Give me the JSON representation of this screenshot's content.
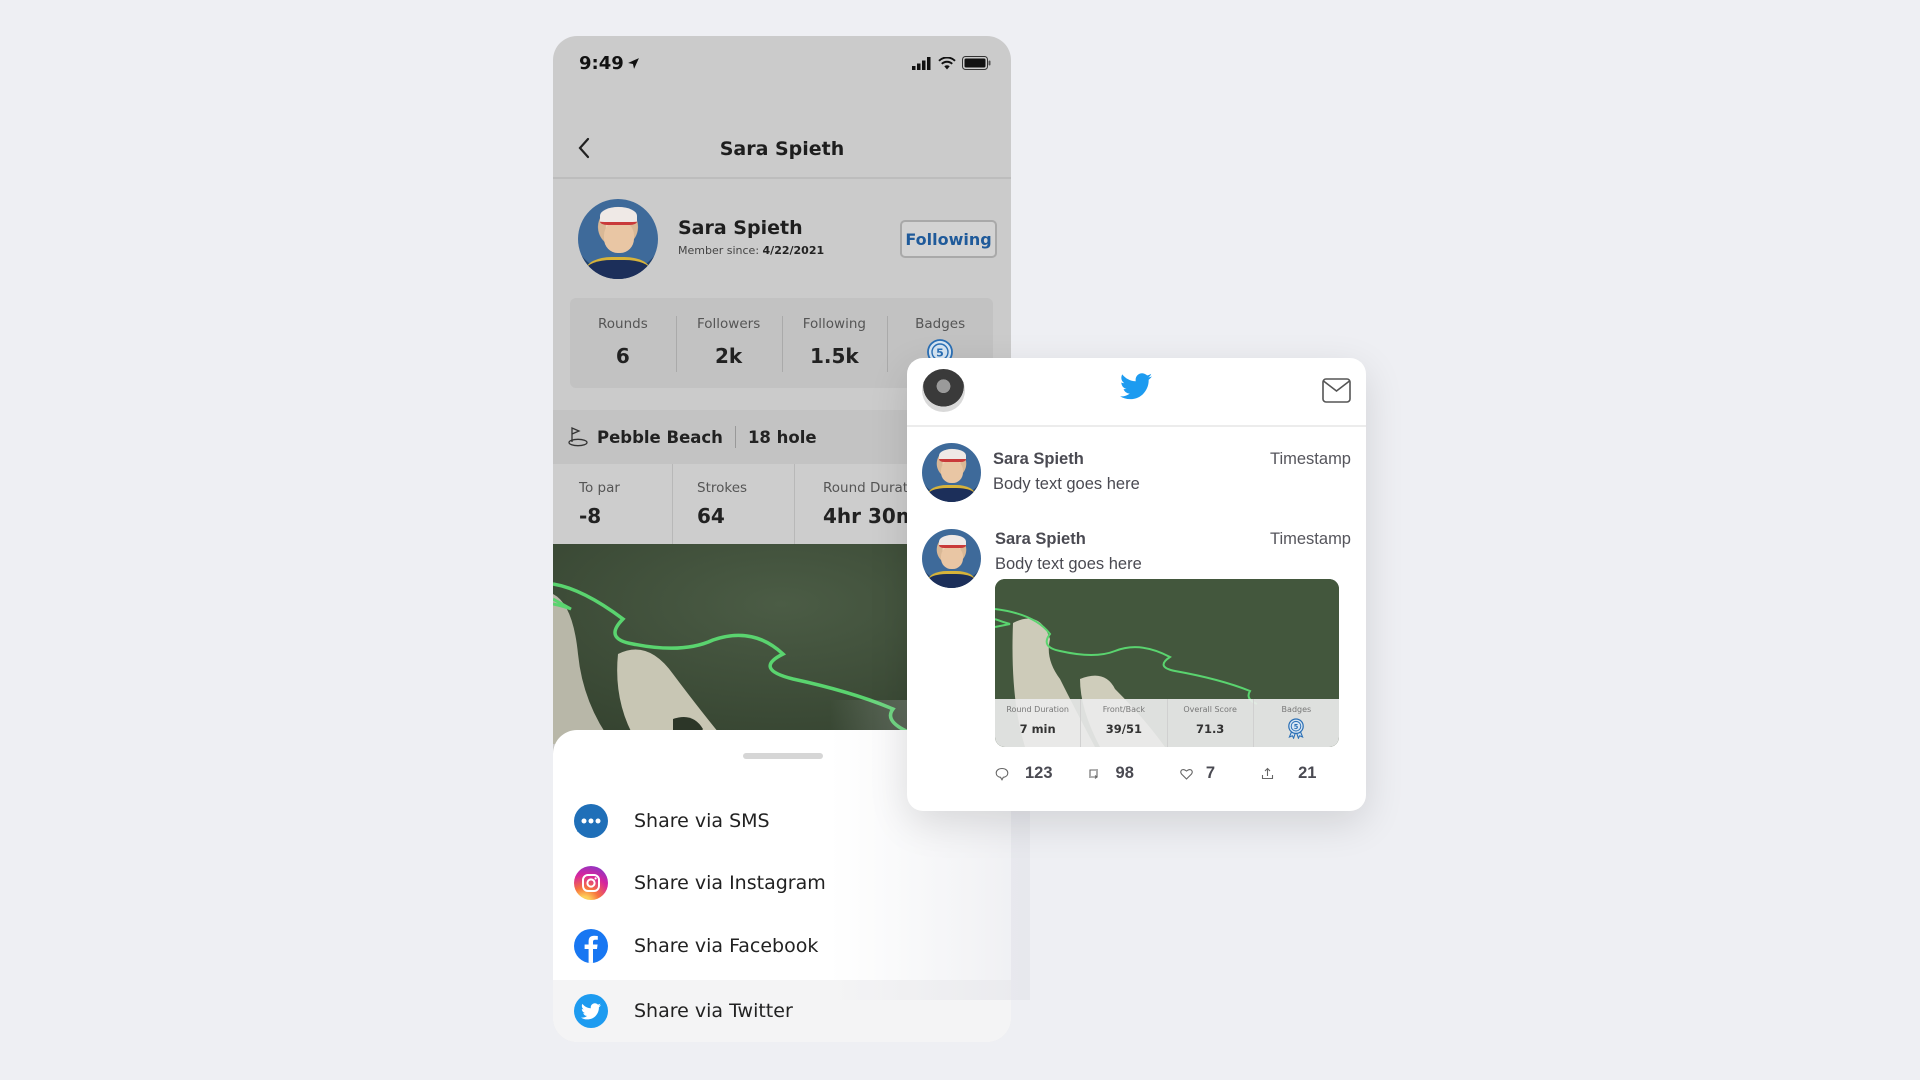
{
  "status_bar": {
    "time": "9:49"
  },
  "header": {
    "title": "Sara Spieth"
  },
  "profile": {
    "name": "Sara Spieth",
    "member_since_label": "Member since:",
    "member_since_date": "4/22/2021",
    "follow_button": "Following",
    "stats": [
      {
        "label": "Rounds",
        "value": "6"
      },
      {
        "label": "Followers",
        "value": "2k"
      },
      {
        "label": "Following",
        "value": "1.5k"
      },
      {
        "label": "Badges",
        "value": "5"
      }
    ]
  },
  "round": {
    "course": "Pebble Beach",
    "holes": "18 hole",
    "stats": [
      {
        "label": "To par",
        "value": "-8"
      },
      {
        "label": "Strokes",
        "value": "64"
      },
      {
        "label": "Round Duration",
        "value": "4hr 30min"
      }
    ]
  },
  "share_sheet": {
    "items": [
      {
        "label": "Share via SMS",
        "icon": "sms-icon",
        "color": "#1f6fb8"
      },
      {
        "label": "Share via Instagram",
        "icon": "instagram-icon",
        "color": "#d6249f"
      },
      {
        "label": "Share via Facebook",
        "icon": "facebook-icon",
        "color": "#1877f2"
      },
      {
        "label": "Share via Twitter",
        "icon": "twitter-icon",
        "color": "#1d9bf0"
      }
    ]
  },
  "twitter": {
    "brand_color": "#1d9bf0",
    "tweets": [
      {
        "name": "Sara Spieth",
        "timestamp": "Timestamp",
        "body": "Body text goes here"
      },
      {
        "name": "Sara Spieth",
        "timestamp": "Timestamp",
        "body": "Body text goes here"
      }
    ],
    "media_stats": [
      {
        "label": "Round Duration",
        "value": "7 min"
      },
      {
        "label": "Front/Back",
        "value": "39/51"
      },
      {
        "label": "Overall Score",
        "value": "71.3"
      },
      {
        "label": "Badges",
        "value": "5"
      }
    ],
    "actions": {
      "replies": "123",
      "retweets": "98",
      "likes": "7",
      "shares": "21"
    }
  }
}
